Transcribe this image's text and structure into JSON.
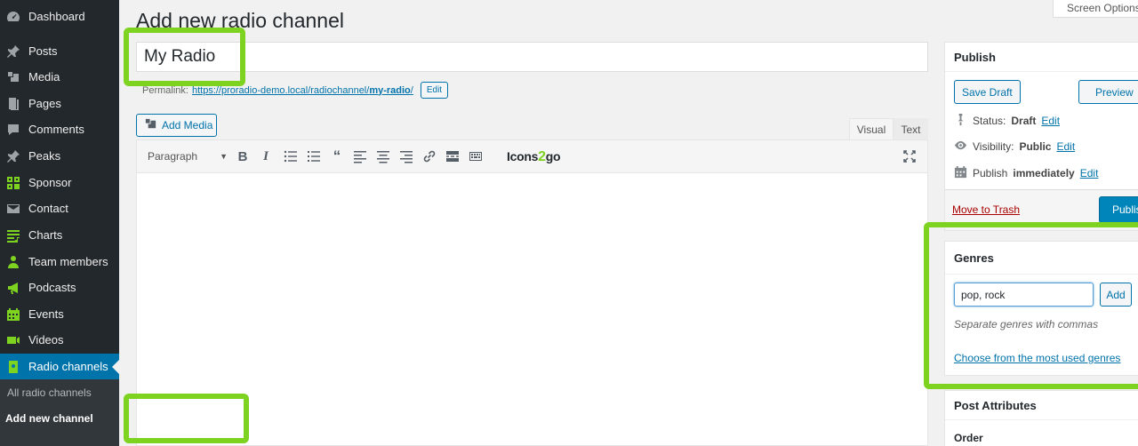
{
  "sidebar": {
    "items": [
      {
        "label": "Dashboard",
        "icon": "dashboard-icon"
      },
      {
        "label": "Posts",
        "icon": "pin-icon"
      },
      {
        "label": "Media",
        "icon": "media-icon"
      },
      {
        "label": "Pages",
        "icon": "pages-icon"
      },
      {
        "label": "Comments",
        "icon": "comment-icon"
      },
      {
        "label": "Peaks",
        "icon": "pin-icon"
      },
      {
        "label": "Sponsor",
        "icon": "grid-icon"
      },
      {
        "label": "Contact",
        "icon": "envelope-icon"
      },
      {
        "label": "Charts",
        "icon": "playlist-icon"
      },
      {
        "label": "Team members",
        "icon": "person-icon"
      },
      {
        "label": "Podcasts",
        "icon": "megaphone-icon"
      },
      {
        "label": "Events",
        "icon": "calendar-icon"
      },
      {
        "label": "Videos",
        "icon": "video-icon"
      },
      {
        "label": "Radio channels",
        "icon": "radio-icon"
      }
    ],
    "submenu": {
      "all_label": "All radio channels",
      "add_label": "Add new channel"
    },
    "colors": {
      "bg": "#23282d",
      "active": "#0073aa",
      "highlight": "#7ed321"
    }
  },
  "header": {
    "title": "Add new radio channel",
    "screen_options": "Screen Options"
  },
  "editor": {
    "title_value": "My Radio",
    "permalink_label": "Permalink:",
    "permalink_base": "https://proradio-demo.local/radiochannel/",
    "permalink_slug": "my-radio",
    "permalink_end": "/",
    "edit_label": "Edit",
    "add_media": "Add Media",
    "tab_visual": "Visual",
    "tab_text": "Text",
    "format": "Paragraph",
    "plugin_logo_a": "Icons",
    "plugin_logo_b": "2",
    "plugin_logo_c": "go"
  },
  "publish": {
    "title": "Publish",
    "save_draft": "Save Draft",
    "preview": "Preview",
    "status_label": "Status:",
    "status_value": "Draft",
    "visibility_label": "Visibility:",
    "visibility_value": "Public",
    "publish_label": "Publish",
    "publish_value": "immediately",
    "edit": "Edit",
    "trash": "Move to Trash",
    "publish_button": "Publish"
  },
  "genres": {
    "title": "Genres",
    "input_value": "pop, rock",
    "add": "Add",
    "help": "Separate genres with commas",
    "choose": "Choose from the most used genres"
  },
  "attributes": {
    "title": "Post Attributes",
    "order_label": "Order"
  }
}
